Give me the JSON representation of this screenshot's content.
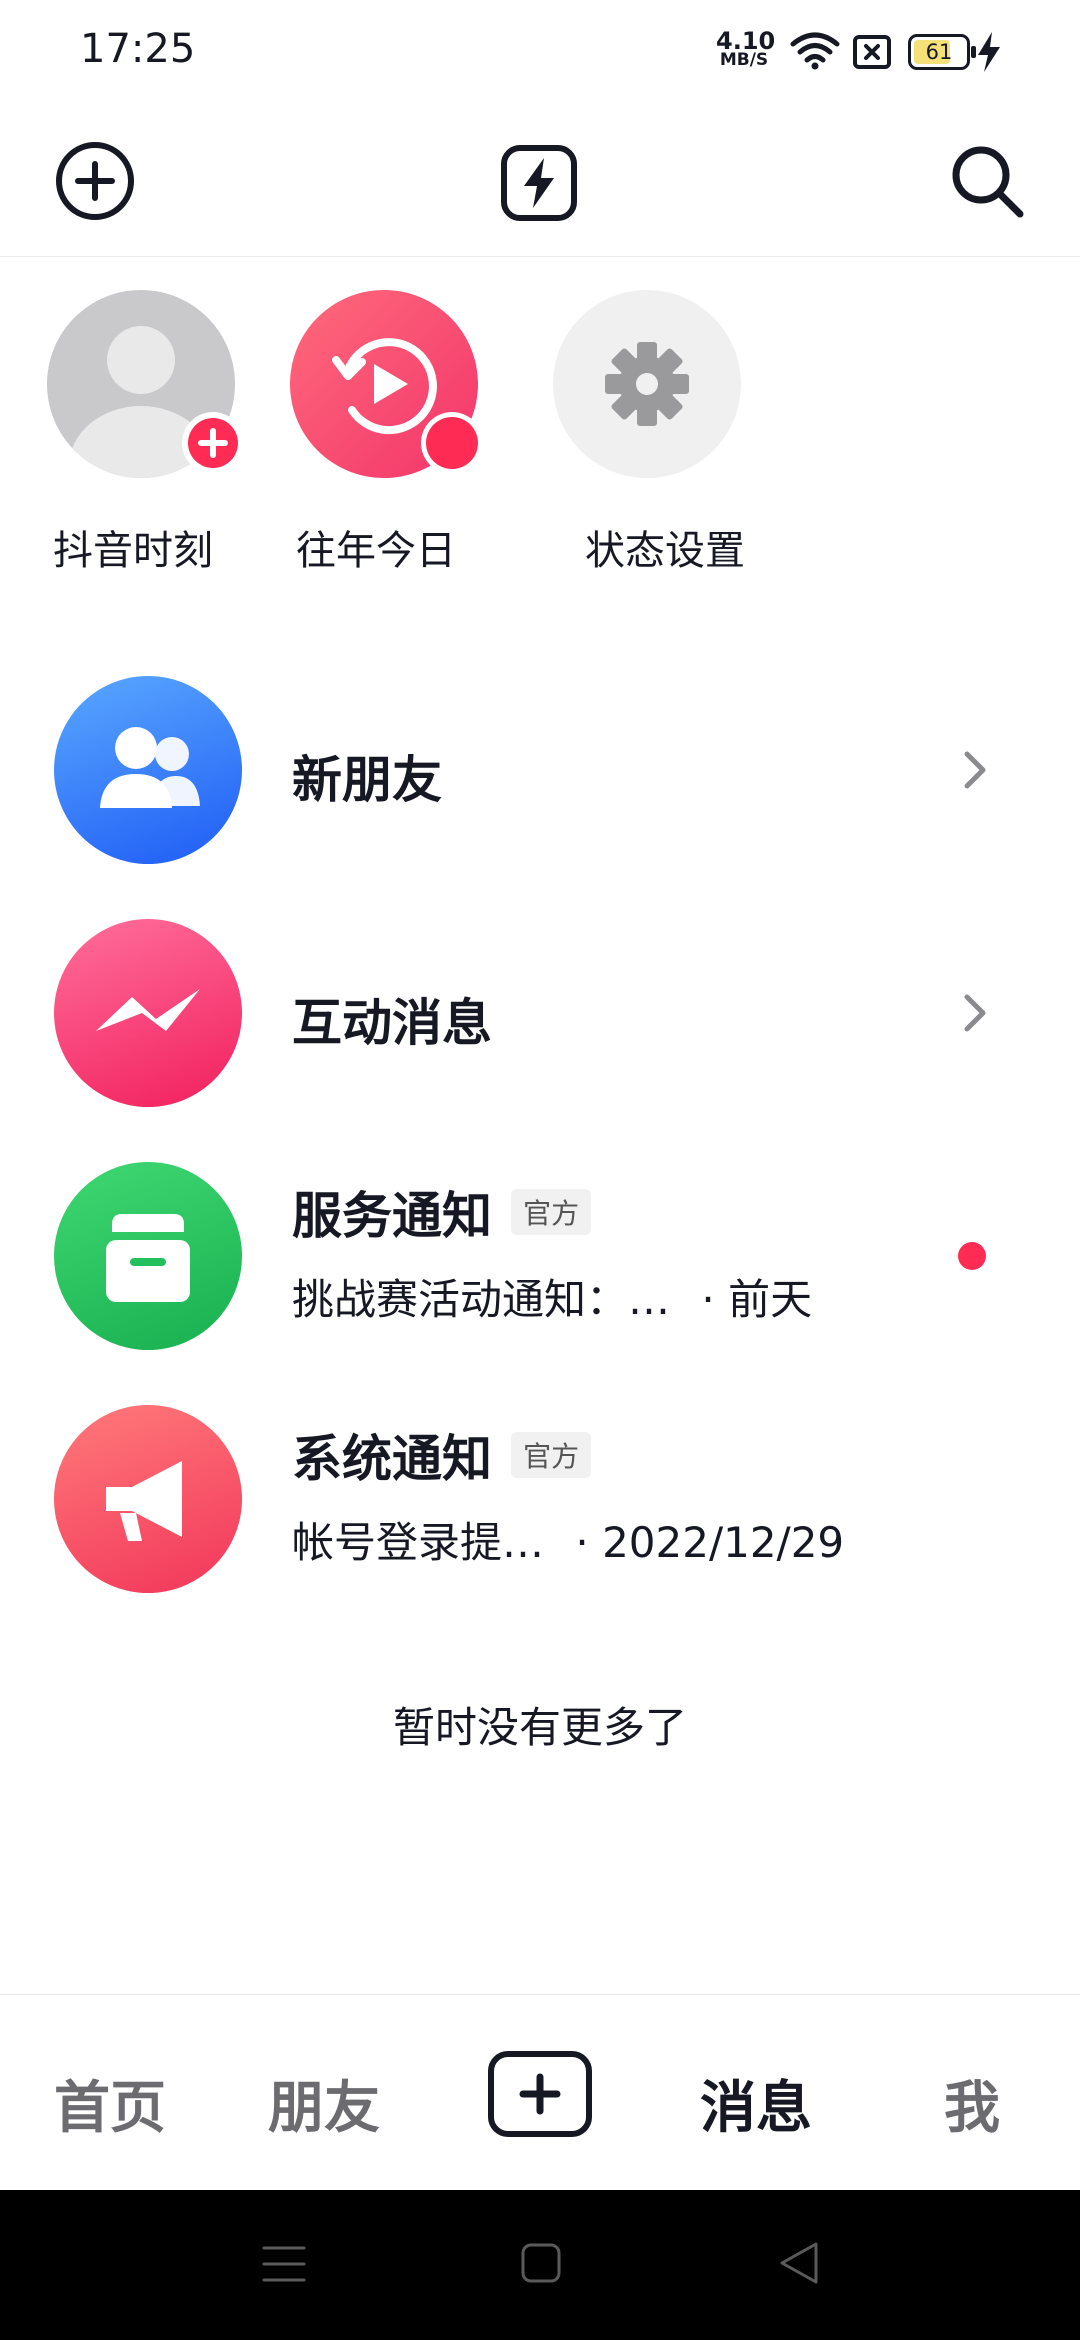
{
  "status_bar": {
    "time": "17:25",
    "net_speed_value": "4.10",
    "net_speed_unit": "MB/S",
    "battery_level": "61",
    "icons": [
      "wifi-icon",
      "sim-disabled-icon",
      "battery-icon",
      "charging-icon"
    ]
  },
  "header": {
    "icons": [
      "add-circle-icon",
      "flash-icon",
      "search-icon"
    ]
  },
  "quick_actions": [
    {
      "label": "抖音时刻",
      "icon": "default-avatar-icon"
    },
    {
      "label": "往年今日",
      "icon": "history-play-icon"
    },
    {
      "label": "状态设置",
      "icon": "gear-icon"
    }
  ],
  "messages": {
    "new_friends": {
      "title": "新朋友",
      "icon": "friends-icon"
    },
    "interactions": {
      "title": "互动消息",
      "icon": "interaction-icon"
    },
    "service": {
      "title": "服务通知",
      "badge": "官方",
      "preview": "挑战赛活动通知：…",
      "time": "· 前天",
      "icon": "inbox-icon",
      "unread": true
    },
    "system": {
      "title": "系统通知",
      "badge": "官方",
      "preview": "帐号登录提…",
      "time": "· 2022/12/29",
      "icon": "megaphone-icon"
    }
  },
  "footer_text": "暂时没有更多了",
  "tabs": {
    "home": "首页",
    "friends": "朋友",
    "messages": "消息",
    "me": "我",
    "active": "messages"
  },
  "colors": {
    "accent_red": "#fe2c55",
    "text_primary": "#161823",
    "blue": "#2c7bf6",
    "green": "#25c05e",
    "pink": "#f93a73"
  }
}
